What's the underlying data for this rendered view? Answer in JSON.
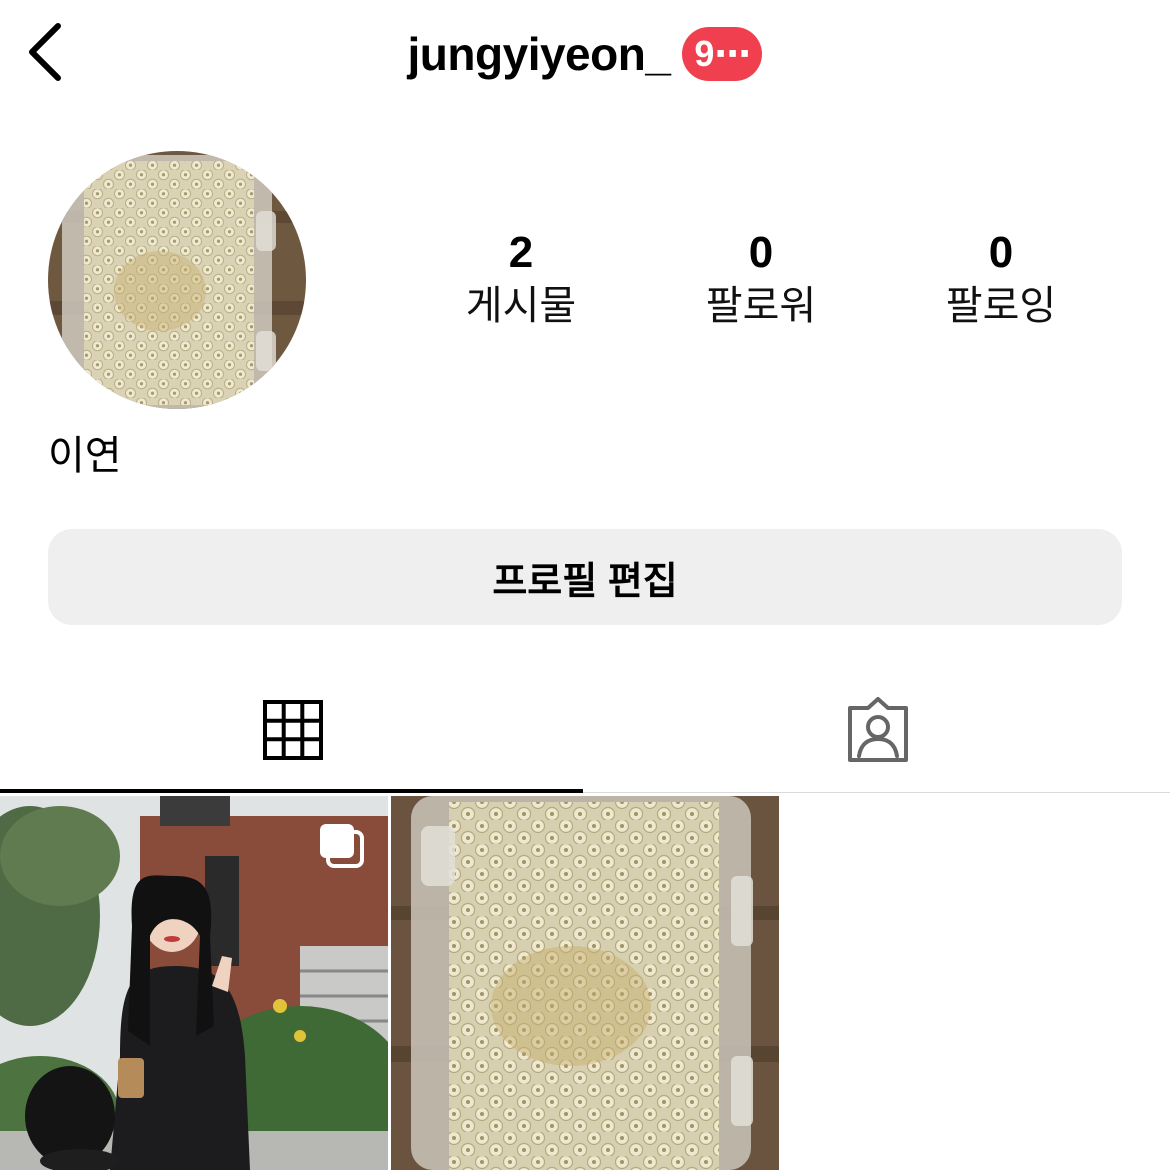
{
  "header": {
    "username": "jungyiyeon_",
    "notification_badge": "9⋯",
    "badge_color": "#f0404f"
  },
  "profile": {
    "display_name": "이연",
    "stats": [
      {
        "value": "2",
        "label": "게시물"
      },
      {
        "value": "0",
        "label": "팔로워"
      },
      {
        "value": "0",
        "label": "팔로잉"
      }
    ],
    "edit_button_label": "프로필 편집"
  },
  "tabs": [
    {
      "icon": "grid-icon",
      "active": true
    },
    {
      "icon": "tagged-person-icon",
      "active": false
    }
  ],
  "posts": [
    {
      "thumbnail": "woman-in-black-hoodie-street-photo",
      "multi_image": true,
      "icon": "multi-image-icon"
    },
    {
      "thumbnail": "honeycomb-in-plastic-container",
      "multi_image": false
    }
  ]
}
